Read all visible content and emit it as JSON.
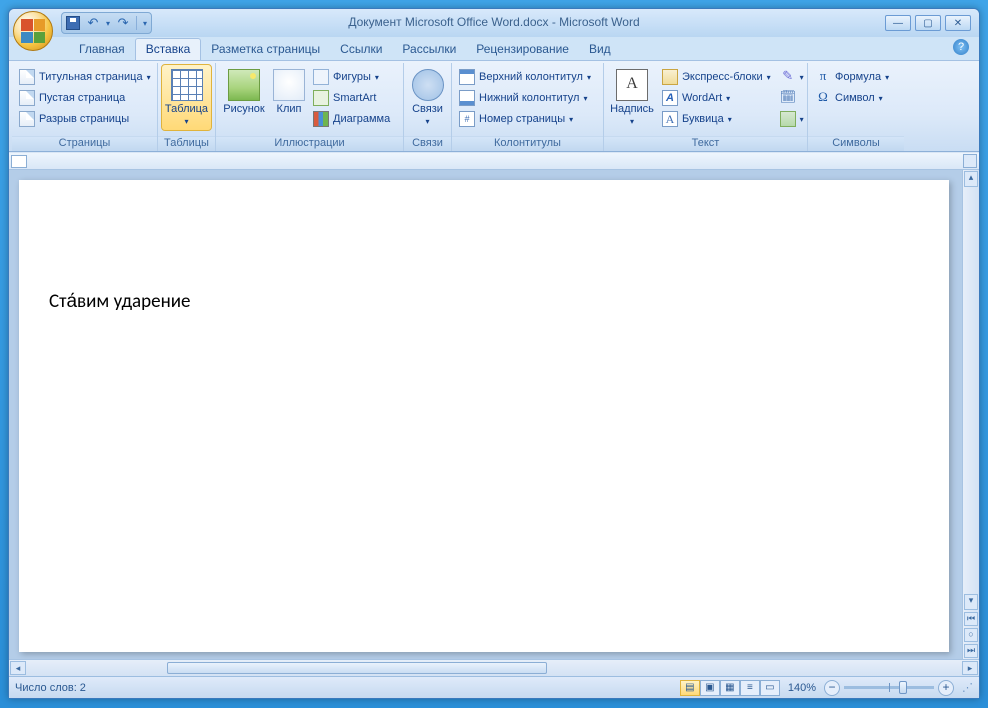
{
  "title": "Документ Microsoft Office Word.docx - Microsoft Word",
  "tabs": {
    "home": "Главная",
    "insert": "Вставка",
    "layout": "Разметка страницы",
    "refs": "Ссылки",
    "mail": "Рассылки",
    "review": "Рецензирование",
    "view": "Вид"
  },
  "groups": {
    "pages": {
      "label": "Страницы",
      "cover": "Титульная страница",
      "blank": "Пустая страница",
      "break": "Разрыв страницы"
    },
    "tables": {
      "label": "Таблицы",
      "table": "Таблица"
    },
    "illus": {
      "label": "Иллюстрации",
      "picture": "Рисунок",
      "clip": "Клип",
      "shapes": "Фигуры",
      "smart": "SmartArt",
      "chart": "Диаграмма"
    },
    "links": {
      "label": "Связи",
      "links": "Связи"
    },
    "headerfooter": {
      "label": "Колонтитулы",
      "header": "Верхний колонтитул",
      "footer": "Нижний колонтитул",
      "pagenum": "Номер страницы"
    },
    "text": {
      "label": "Текст",
      "textbox": "Надпись",
      "quick": "Экспресс-блоки",
      "wordart": "WordArt",
      "dropcap": "Буквица"
    },
    "symbols": {
      "label": "Символы",
      "equation": "Формула",
      "symbol": "Символ"
    }
  },
  "document": {
    "text": "Ста́вим ударение"
  },
  "status": {
    "wordcount": "Число слов: 2",
    "zoom": "140%"
  }
}
